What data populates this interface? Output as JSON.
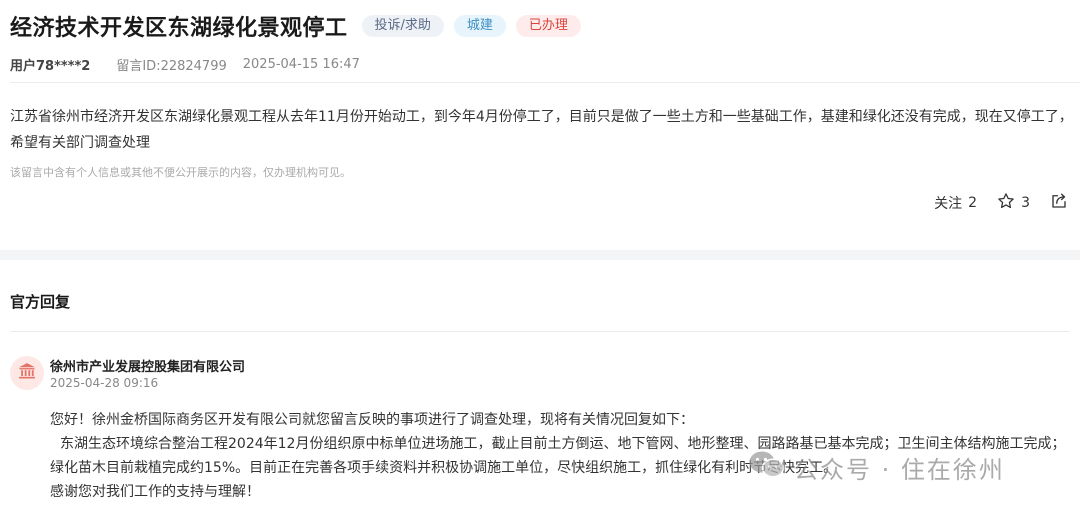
{
  "header": {
    "title": "经济技术开发区东湖绿化景观停工",
    "tags": {
      "type": "投诉/求助",
      "category": "城建",
      "status": "已办理"
    }
  },
  "meta": {
    "user": "用户78****2",
    "message_id": "留言ID:22824799",
    "datetime": "2025-04-15 16:47"
  },
  "message": {
    "content": "江苏省徐州市经济开发区东湖绿化景观工程从去年11月份开始动工，到今年4月份停工了，目前只是做了一些土方和一些基础工作，基建和绿化还没有完成，现在又停工了，希望有关部门调查处理",
    "privacy_note": "该留言中含有个人信息或其他不便公开展示的内容，仅办理机构可见。"
  },
  "actions": {
    "follow_label": "关注",
    "follow_count": "2",
    "star_count": "3"
  },
  "official_reply": {
    "section_title": "官方回复",
    "org_name": "徐州市产业发展控股集团有限公司",
    "datetime": "2025-04-28 09:16",
    "paragraphs": [
      "您好！徐州金桥国际商务区开发有限公司就您留言反映的事项进行了调查处理，现将有关情况回复如下：",
      "东湖生态环境综合整治工程2024年12月份组织原中标单位进场施工，截止目前土方倒运、地下管网、地形整理、园路路基已基本完成；卫生间主体结构施工完成；绿化苗木目前栽植完成约15%。目前正在完善各项手续资料并积极协调施工单位，尽快组织施工，抓住绿化有利时节尽快完工。",
      "感谢您对我们工作的支持与理解！"
    ]
  },
  "watermark": {
    "text": "公众号 · 住在徐州"
  },
  "icons": {
    "star": "star-outline-icon",
    "share": "share-icon",
    "org": "government-building-icon",
    "wechat": "wechat-icon"
  },
  "colors": {
    "status_red": "#d9453c",
    "category_blue": "#3b8fc4",
    "org_icon_red": "#e57368"
  }
}
